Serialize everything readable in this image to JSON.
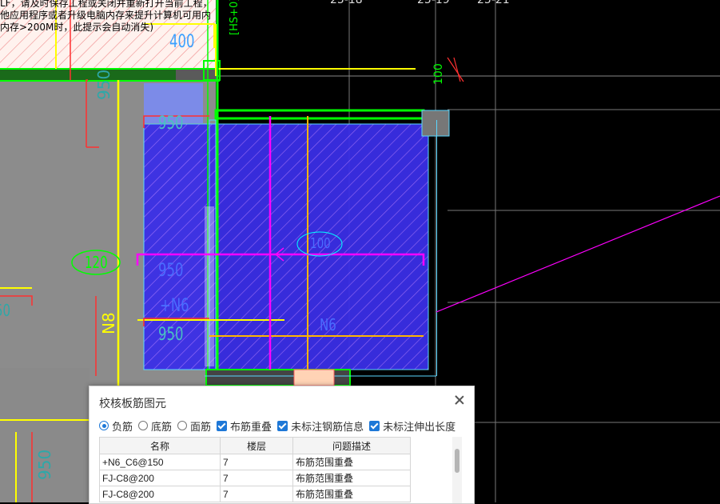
{
  "warning": {
    "lines": [
      "LF，请及时保存工程或关闭并重新打开当前工程，",
      "他应用程序或者升级电脑内存来提升计算机可用内",
      "内存>200M时，此提示会自动消失)"
    ]
  },
  "canvas": {
    "axis_labels": [
      "25-18",
      "25-19",
      "25-21"
    ],
    "dims": {
      "d400": "400",
      "d950_v": "950",
      "d950_a": "950",
      "d120": "120",
      "d950_b": "950",
      "dN6": "+N6",
      "d950_c": "950",
      "dN8": "N8",
      "d50": "50",
      "d950_d": "950",
      "d100": "100",
      "dHS": "[HS+0]",
      "d100b": "100",
      "dN6b": "N6"
    }
  },
  "dialog": {
    "title": "校核板筋图元",
    "options": [
      {
        "label": "负筋",
        "kind": "radio",
        "checked": true
      },
      {
        "label": "底筋",
        "kind": "radio",
        "checked": false
      },
      {
        "label": "面筋",
        "kind": "radio",
        "checked": false
      },
      {
        "label": "布筋重叠",
        "kind": "checkbox",
        "checked": true
      },
      {
        "label": "未标注钢筋信息",
        "kind": "checkbox",
        "checked": true
      },
      {
        "label": "未标注伸出长度",
        "kind": "checkbox",
        "checked": true
      }
    ],
    "columns": [
      "名称",
      "楼层",
      "问题描述"
    ],
    "rows": [
      {
        "name": "+N6_C6@150",
        "floor": "7",
        "desc": "布筋范围重叠"
      },
      {
        "name": "FJ-C8@200",
        "floor": "7",
        "desc": "布筋范围重叠"
      },
      {
        "name": "FJ-C8@200",
        "floor": "7",
        "desc": "布筋范围重叠"
      }
    ]
  },
  "colors": {
    "background": "#000000",
    "slab_gray": "#8c8c8c",
    "selection_blue": "#3a2ee6",
    "rebar_magenta": "#ff00ff",
    "beam_green": "#00ff00",
    "rebar_yellow": "#ffff00",
    "accent": "#1e78d7"
  }
}
